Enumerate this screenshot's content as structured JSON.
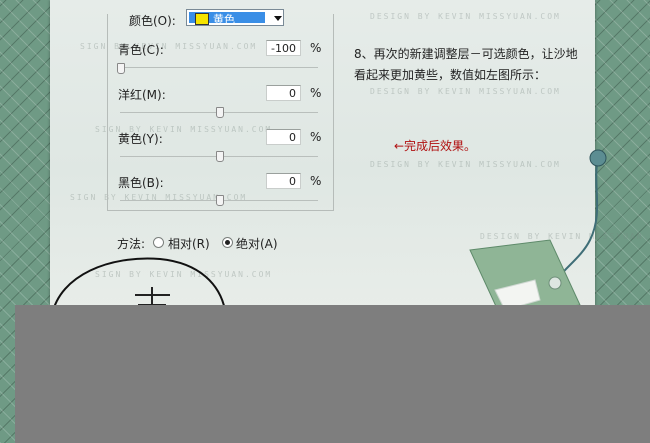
{
  "dialog": {
    "colors_label": "颜色(O):",
    "colors_value": "黄色",
    "swatch_color": "#f5e400",
    "rows": [
      {
        "label": "青色(C):",
        "value": "-100",
        "unit": "%",
        "slider": 0.0
      },
      {
        "label": "洋红(M):",
        "value": "0",
        "unit": "%",
        "slider": 0.5
      },
      {
        "label": "黄色(Y):",
        "value": "0",
        "unit": "%",
        "slider": 0.5
      },
      {
        "label": "黑色(B):",
        "value": "0",
        "unit": "%",
        "slider": 0.5
      }
    ],
    "method_label": "方法:",
    "relative_label": "相对(R)",
    "absolute_label": "绝对(A)",
    "selected_method": "absolute"
  },
  "note": {
    "text": "8、再次的新建调整层－可选颜色，让沙地看起来更加黄些，数值如左图所示："
  },
  "result": {
    "text": "←完成后效果。"
  },
  "watermark": "SIGN BY KEVIN MISSYUAN.COM",
  "watermark_alt": "DESIGN BY KEVIN MISSYUAN.COM",
  "colors": {
    "background": "#6f9a85",
    "paper": "#e3eae6",
    "accent_blue": "#3a8ee6",
    "note_red": "#b01010",
    "bottom_gray": "#7e7e7e"
  }
}
